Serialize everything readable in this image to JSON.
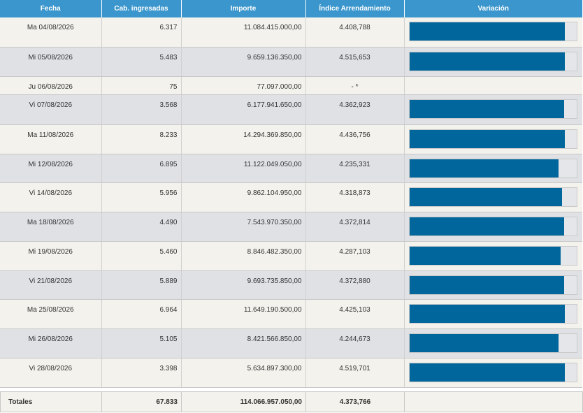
{
  "headers": {
    "fecha": "Fecha",
    "cabezas": "Cab. ingresadas",
    "importe": "Importe",
    "indice": "Índice Arrendamiento",
    "variacion": "Variación"
  },
  "rows": [
    {
      "fecha": "Ma 04/08/2026",
      "cabezas": "6.317",
      "importe": "11.084.415.000,00",
      "indice": "4.408,788",
      "variacion": 0.93
    },
    {
      "fecha": "Mi 05/08/2026",
      "cabezas": "5.483",
      "importe": "9.659.136.350,00",
      "indice": "4.515,653",
      "variacion": 0.93
    },
    {
      "fecha": "Ju 06/08/2026",
      "cabezas": "75",
      "importe": "77.097.000,00",
      "indice": "- *",
      "variacion": null
    },
    {
      "fecha": "Vi 07/08/2026",
      "cabezas": "3.568",
      "importe": "6.177.941.650,00",
      "indice": "4.362,923",
      "variacion": 0.925
    },
    {
      "fecha": "Ma 11/08/2026",
      "cabezas": "8.233",
      "importe": "14.294.369.850,00",
      "indice": "4.436,756",
      "variacion": 0.93
    },
    {
      "fecha": "Mi 12/08/2026",
      "cabezas": "6.895",
      "importe": "11.122.049.050,00",
      "indice": "4.235,331",
      "variacion": 0.895
    },
    {
      "fecha": "Vi 14/08/2026",
      "cabezas": "5.956",
      "importe": "9.862.104.950,00",
      "indice": "4.318,873",
      "variacion": 0.915
    },
    {
      "fecha": "Ma 18/08/2026",
      "cabezas": "4.490",
      "importe": "7.543.970.350,00",
      "indice": "4.372,814",
      "variacion": 0.925
    },
    {
      "fecha": "Mi 19/08/2026",
      "cabezas": "5.460",
      "importe": "8.846.482.350,00",
      "indice": "4.287,103",
      "variacion": 0.905
    },
    {
      "fecha": "Vi 21/08/2026",
      "cabezas": "5.889",
      "importe": "9.693.735.850,00",
      "indice": "4.372,880",
      "variacion": 0.925
    },
    {
      "fecha": "Ma 25/08/2026",
      "cabezas": "6.964",
      "importe": "11.649.190.500,00",
      "indice": "4.425,103",
      "variacion": 0.93
    },
    {
      "fecha": "Mi 26/08/2026",
      "cabezas": "5.105",
      "importe": "8.421.566.850,00",
      "indice": "4.244,673",
      "variacion": 0.895
    },
    {
      "fecha": "Vi 28/08/2026",
      "cabezas": "3.398",
      "importe": "5.634.897.300,00",
      "indice": "4.519,701",
      "variacion": 0.93
    }
  ],
  "totals": {
    "label": "Totales",
    "cabezas": "67.833",
    "importe": "114.066.957.050,00",
    "indice": "4.373,766"
  },
  "colors": {
    "header_bg": "#3a96cc",
    "bar_fill": "#00669c",
    "bar_track": "#e4e6e9",
    "row_odd": "#f3f2ec",
    "row_even": "#dfe1e5"
  }
}
